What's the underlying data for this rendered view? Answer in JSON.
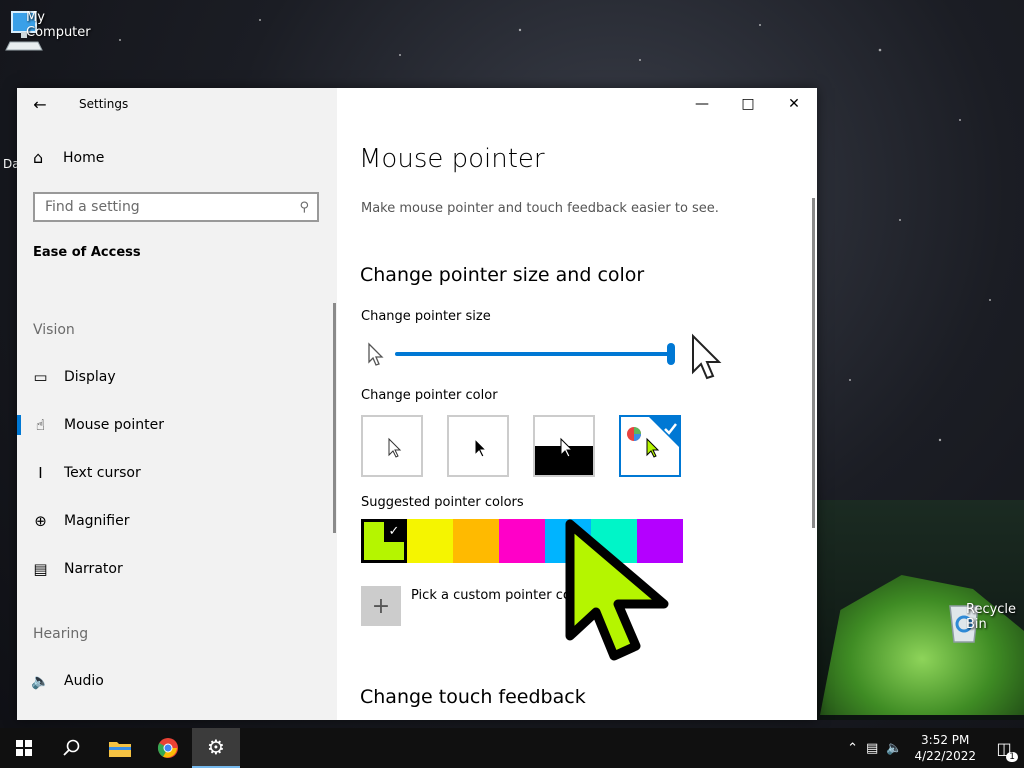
{
  "desktop": {
    "icons": [
      {
        "label": "My Computer"
      },
      {
        "label": "Recycle Bin"
      }
    ],
    "partial_label": "Da"
  },
  "window": {
    "title": "Settings",
    "controls": {
      "minimize": "—",
      "maximize": "□",
      "close": "✕"
    }
  },
  "sidebar": {
    "home": "Home",
    "search_placeholder": "Find a setting",
    "section_title": "Ease of Access",
    "groups": [
      {
        "title": "Vision",
        "items": [
          {
            "label": "Display",
            "icon": "monitor-icon",
            "selected": false
          },
          {
            "label": "Mouse pointer",
            "icon": "mouse-pointer-icon",
            "selected": true
          },
          {
            "label": "Text cursor",
            "icon": "text-cursor-icon",
            "selected": false
          },
          {
            "label": "Magnifier",
            "icon": "magnifier-icon",
            "selected": false
          },
          {
            "label": "Narrator",
            "icon": "narrator-icon",
            "selected": false
          }
        ]
      },
      {
        "title": "Hearing",
        "items": [
          {
            "label": "Audio",
            "icon": "speaker-icon",
            "selected": false
          }
        ]
      }
    ]
  },
  "main": {
    "heading": "Mouse pointer",
    "description": "Make mouse pointer and touch feedback easier to see.",
    "section_pointer": "Change pointer size and color",
    "size_label": "Change pointer size",
    "size_value": 1.0,
    "color_label": "Change pointer color",
    "color_options": [
      {
        "name": "white",
        "selected": false
      },
      {
        "name": "black",
        "selected": false
      },
      {
        "name": "inverted",
        "selected": false
      },
      {
        "name": "custom",
        "selected": true
      }
    ],
    "suggested_label": "Suggested pointer colors",
    "suggested_colors": [
      {
        "color": "#b5f500",
        "selected": true
      },
      {
        "color": "#f5f500",
        "selected": false
      },
      {
        "color": "#ffba00",
        "selected": false
      },
      {
        "color": "#ff00c8",
        "selected": false
      },
      {
        "color": "#00b4ff",
        "selected": false
      },
      {
        "color": "#00f5c8",
        "selected": false
      },
      {
        "color": "#b400ff",
        "selected": false
      }
    ],
    "custom_label": "Pick a custom pointer color",
    "section_touch": "Change touch feedback"
  },
  "taskbar": {
    "time": "3:52 PM",
    "date": "4/22/2022",
    "notification_count": "1",
    "accent": "#0078d4"
  }
}
